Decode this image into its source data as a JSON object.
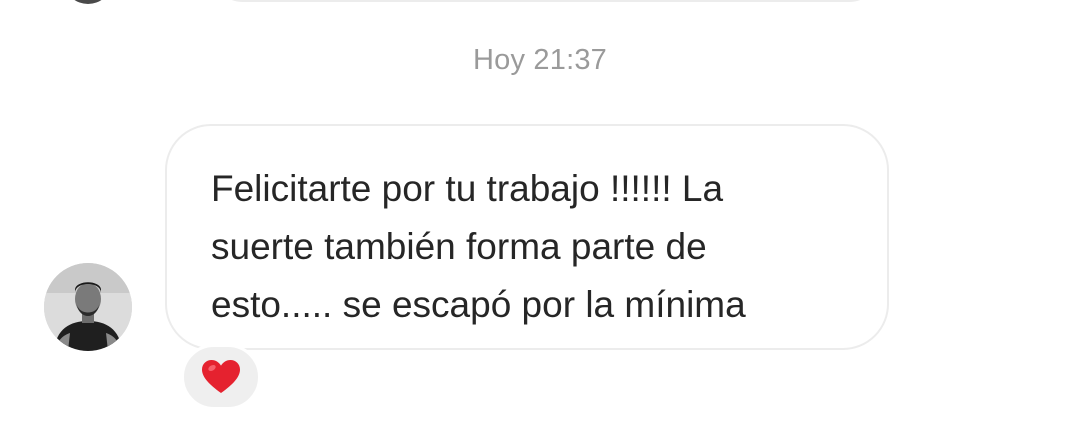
{
  "timestamp": "Hoy 21:37",
  "message": {
    "lines": [
      "Felicitarte por tu trabajo !!!!!! La",
      "suerte también forma parte de",
      "esto..... se escapó por la mínima"
    ]
  },
  "reaction": {
    "icon": "red-heart-icon",
    "color": "#e5222f"
  },
  "avatar": {
    "icon": "person-photo"
  }
}
